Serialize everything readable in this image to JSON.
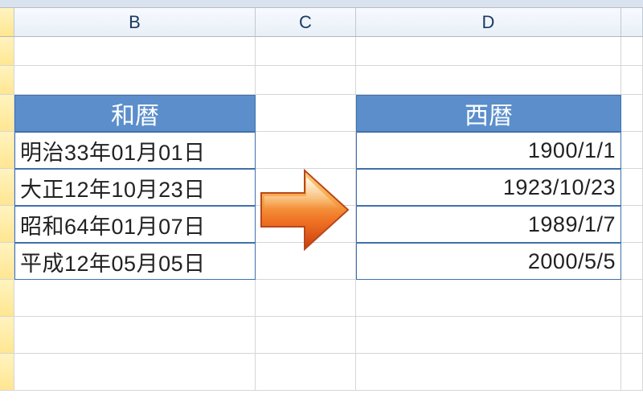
{
  "columns": {
    "A": "",
    "B": "B",
    "C": "C",
    "D": "D"
  },
  "tableB": {
    "header": "和暦",
    "rows": [
      "明治33年01月01日",
      "大正12年10月23日",
      "昭和64年01月07日",
      "平成12年05月05日"
    ]
  },
  "tableD": {
    "header": "西暦",
    "rows": [
      "1900/1/1",
      "1923/10/23",
      "1989/1/7",
      "2000/5/5"
    ]
  },
  "arrow": {
    "name": "right-arrow-icon",
    "fill1": "#f7a84a",
    "fill2": "#d94b16"
  }
}
